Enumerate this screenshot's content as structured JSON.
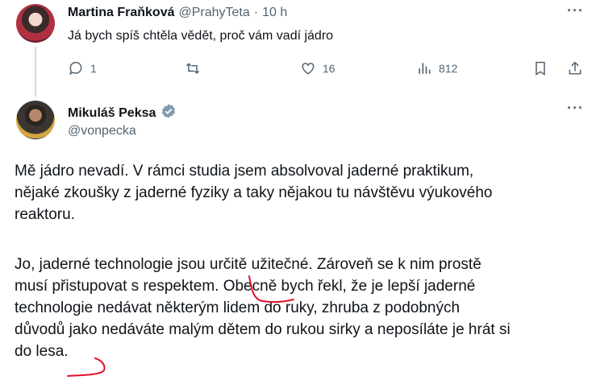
{
  "reply_tweet": {
    "author_name": "Martina Fraňková",
    "handle": "@PrahyTeta",
    "separator": "·",
    "time": "10 h",
    "text": "Já bych spíš chtěla vědět, proč vám vadí jádro",
    "actions": {
      "replies": "1",
      "retweets": "",
      "likes": "16",
      "views": "812"
    }
  },
  "main_tweet": {
    "author_name": "Mikuláš Peksa",
    "handle": "@vonpecka",
    "verified_color": "#829aab",
    "paragraph_1": "Mě jádro nevadí. V rámci studia jsem absolvoval jaderné praktikum,\nnějaké zkoušky z jaderné fyziky a taky nějakou tu návštěvu výukového\nreaktoru.",
    "paragraph_2": "Jo, jaderné technologie jsou určitě užitečné. Zároveň se k nim prostě\nmusí přistupovat s respektem. Obecně bych řekl, že je lepší jaderné\ntechnologie nedávat některým lidem do ruky, zhruba z podobných\ndůvodů jako nedáváte malým dětem do rukou sirky a neposíláte je hrát si\ndo lesa."
  },
  "annotation_color": "#e0102b",
  "icons": [
    "more-icon",
    "reply-icon",
    "retweet-icon",
    "like-icon",
    "views-icon",
    "bookmark-icon",
    "share-icon",
    "verified-badge-icon"
  ]
}
